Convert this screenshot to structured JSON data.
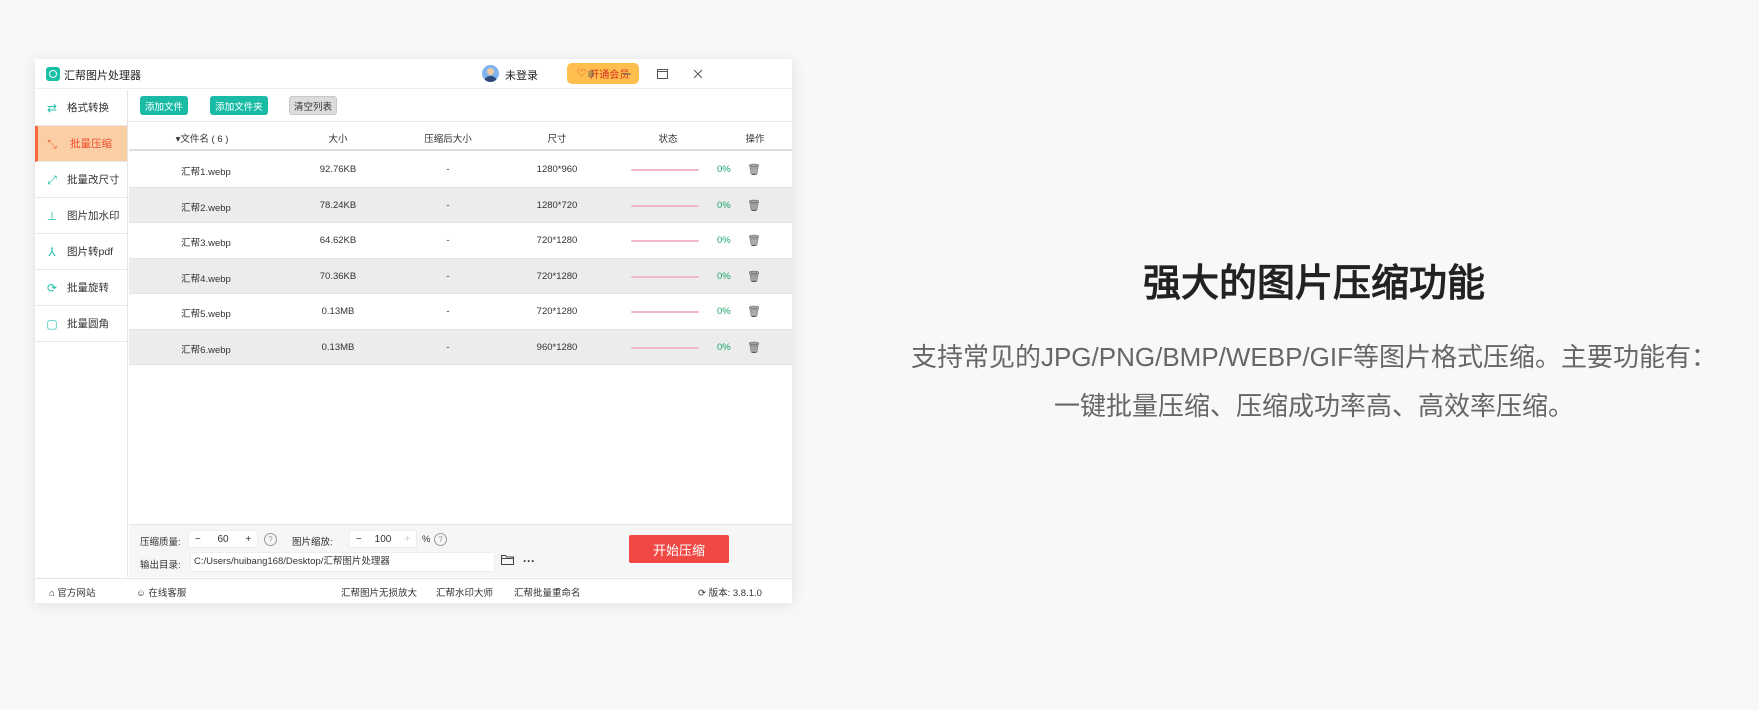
{
  "app": {
    "title": "汇帮图片处理器",
    "user_label": "未登录",
    "vip_label": "开通会员",
    "menu_icon": "hamburger-icon",
    "minimize_icon": "minimize-icon",
    "maximize_icon": "maximize-icon",
    "close_icon": "close-icon"
  },
  "sidebar": {
    "items": [
      {
        "label": "格式转换",
        "icon": "format-convert-icon"
      },
      {
        "label": "批量压缩",
        "icon": "compress-icon",
        "active": true
      },
      {
        "label": "批量改尺寸",
        "icon": "resize-icon"
      },
      {
        "label": "图片加水印",
        "icon": "watermark-icon"
      },
      {
        "label": "图片转pdf",
        "icon": "pdf-icon"
      },
      {
        "label": "批量旋转",
        "icon": "rotate-icon"
      },
      {
        "label": "批量圆角",
        "icon": "round-corner-icon"
      }
    ]
  },
  "toolbar": {
    "add_file": "添加文件",
    "add_folder": "添加文件夹",
    "clear_list": "清空列表"
  },
  "table": {
    "headers": {
      "name": "文件名 ( 6 )",
      "size": "大小",
      "compressed_size": "压缩后大小",
      "dimensions": "尺寸",
      "status": "状态",
      "action": "操作"
    },
    "rows": [
      {
        "name": "汇帮1.webp",
        "size": "92.76KB",
        "compressed": "-",
        "dimensions": "1280*960",
        "progress": "0%"
      },
      {
        "name": "汇帮2.webp",
        "size": "78.24KB",
        "compressed": "-",
        "dimensions": "1280*720",
        "progress": "0%"
      },
      {
        "name": "汇帮3.webp",
        "size": "64.62KB",
        "compressed": "-",
        "dimensions": "720*1280",
        "progress": "0%"
      },
      {
        "name": "汇帮4.webp",
        "size": "70.36KB",
        "compressed": "-",
        "dimensions": "720*1280",
        "progress": "0%"
      },
      {
        "name": "汇帮5.webp",
        "size": "0.13MB",
        "compressed": "-",
        "dimensions": "720*1280",
        "progress": "0%"
      },
      {
        "name": "汇帮6.webp",
        "size": "0.13MB",
        "compressed": "-",
        "dimensions": "960*1280",
        "progress": "0%"
      }
    ]
  },
  "settings": {
    "quality_label": "压缩质量:",
    "quality_value": "60",
    "scale_label": "图片缩放:",
    "scale_value": "100",
    "scale_unit": "%",
    "minus": "−",
    "plus": "+",
    "help": "?",
    "output_label": "输出目录:",
    "output_path": "C:/Users/huibang168/Desktop/汇帮图片处理器",
    "more": "···",
    "start_button": "开始压缩"
  },
  "statusbar": {
    "website": "官方网站",
    "support": "在线客服",
    "link1": "汇帮图片无损放大",
    "link2": "汇帮水印大师",
    "link3": "汇帮批量重命名",
    "version": "版本: 3.8.1.0"
  },
  "promo": {
    "headline": "强大的图片压缩功能",
    "description": "支持常见的JPG/PNG/BMP/WEBP/GIF等图片格式压缩。主要功能有：一键批量压缩、压缩成功率高、高效率压缩。"
  },
  "colors": {
    "accent": "#19bba6",
    "active_bg": "#fbcfa6",
    "start_button": "#f04845"
  }
}
